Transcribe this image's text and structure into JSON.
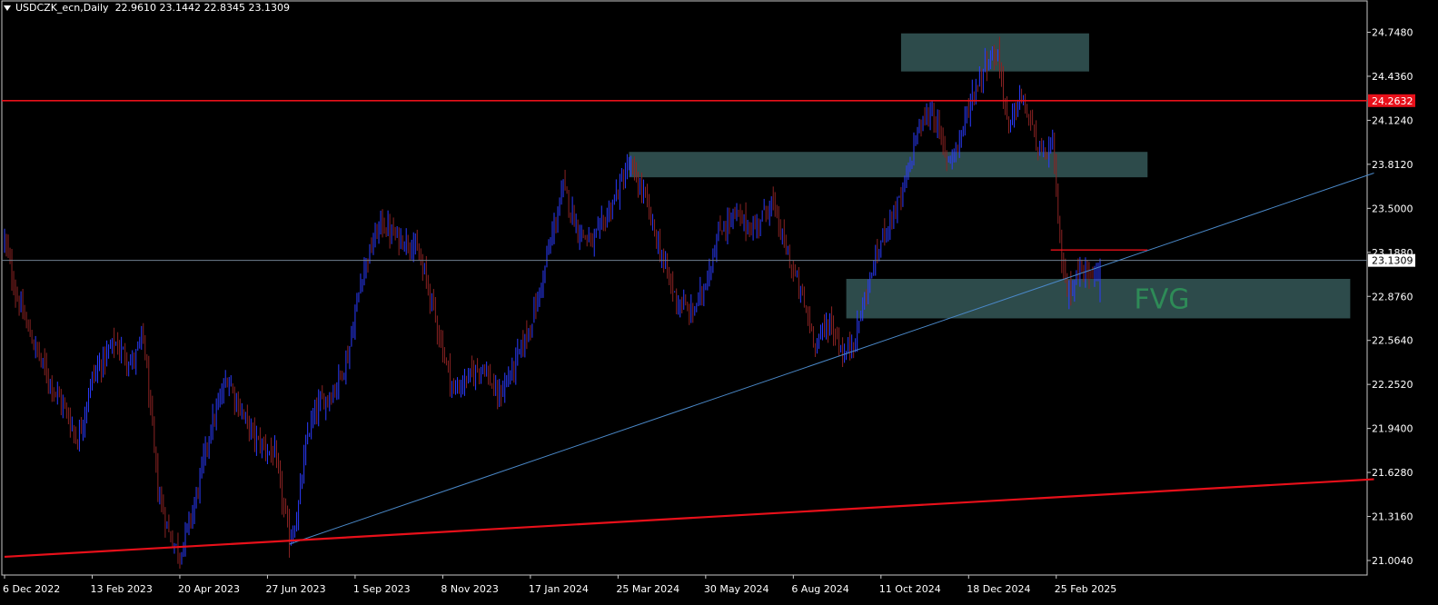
{
  "header": {
    "symbol_line": "USDCZK_ecn,Daily",
    "ohlc": "22.9610 23.1442 22.8345 23.1309"
  },
  "colors": {
    "background": "#000000",
    "bull": "#2b3bff",
    "bear": "#8b2323",
    "zone_fill": "#2f4f4f",
    "horizontal_red": "#e8101a",
    "trendline_blue": "#4a88c8",
    "current_price_line": "#708090",
    "fvg_text": "#2e8b57"
  },
  "chart_data": {
    "type": "candlestick",
    "symbol": "USDCZK_ecn",
    "timeframe": "Daily",
    "last_ohlc": {
      "open": 22.961,
      "high": 23.1442,
      "low": 22.8345,
      "close": 23.1309
    },
    "y_axis": {
      "ticks": [
        "24.7480",
        "24.4360",
        "24.1240",
        "23.8120",
        "23.5000",
        "23.1880",
        "22.8760",
        "22.5640",
        "22.2520",
        "21.9400",
        "21.6280",
        "21.3160",
        "21.0040"
      ],
      "range": [
        20.95,
        24.87
      ]
    },
    "x_axis": {
      "ticks": [
        "6 Dec 2022",
        "13 Feb 2023",
        "20 Apr 2023",
        "27 Jun 2023",
        "1 Sep 2023",
        "8 Nov 2023",
        "17 Jan 2024",
        "25 Mar 2024",
        "30 May 2024",
        "6 Aug 2024",
        "11 Oct 2024",
        "18 Dec 2024",
        "25 Feb 2025"
      ],
      "tick_slots": [
        0,
        48,
        96,
        144,
        192,
        240,
        288,
        336,
        384,
        432,
        480,
        528,
        576
      ],
      "slot_count": 750
    },
    "price_path": [
      [
        0,
        23.28
      ],
      [
        6,
        22.9
      ],
      [
        14,
        22.6
      ],
      [
        24,
        22.3
      ],
      [
        34,
        22.05
      ],
      [
        40,
        21.85
      ],
      [
        48,
        22.3
      ],
      [
        60,
        22.55
      ],
      [
        70,
        22.4
      ],
      [
        76,
        22.6
      ],
      [
        84,
        21.5
      ],
      [
        90,
        21.2
      ],
      [
        96,
        21.05
      ],
      [
        104,
        21.4
      ],
      [
        112,
        21.9
      ],
      [
        122,
        22.3
      ],
      [
        130,
        22.05
      ],
      [
        138,
        21.85
      ],
      [
        148,
        21.75
      ],
      [
        156,
        21.15
      ],
      [
        160,
        21.3
      ],
      [
        166,
        21.9
      ],
      [
        172,
        22.1
      ],
      [
        180,
        22.2
      ],
      [
        188,
        22.45
      ],
      [
        196,
        23.05
      ],
      [
        206,
        23.4
      ],
      [
        214,
        23.3
      ],
      [
        224,
        23.25
      ],
      [
        232,
        22.95
      ],
      [
        240,
        22.5
      ],
      [
        246,
        22.2
      ],
      [
        254,
        22.3
      ],
      [
        262,
        22.4
      ],
      [
        270,
        22.15
      ],
      [
        278,
        22.35
      ],
      [
        286,
        22.6
      ],
      [
        292,
        22.85
      ],
      [
        298,
        23.2
      ],
      [
        306,
        23.65
      ],
      [
        314,
        23.35
      ],
      [
        322,
        23.25
      ],
      [
        330,
        23.45
      ],
      [
        342,
        23.8
      ],
      [
        350,
        23.6
      ],
      [
        360,
        23.15
      ],
      [
        368,
        22.85
      ],
      [
        376,
        22.75
      ],
      [
        382,
        22.9
      ],
      [
        392,
        23.35
      ],
      [
        400,
        23.45
      ],
      [
        410,
        23.35
      ],
      [
        420,
        23.55
      ],
      [
        428,
        23.2
      ],
      [
        436,
        22.9
      ],
      [
        444,
        22.55
      ],
      [
        452,
        22.7
      ],
      [
        460,
        22.45
      ],
      [
        466,
        22.6
      ],
      [
        474,
        23.0
      ],
      [
        482,
        23.35
      ],
      [
        492,
        23.6
      ],
      [
        500,
        24.05
      ],
      [
        508,
        24.2
      ],
      [
        516,
        23.85
      ],
      [
        522,
        23.95
      ],
      [
        530,
        24.3
      ],
      [
        538,
        24.55
      ],
      [
        544,
        24.6
      ],
      [
        550,
        24.05
      ],
      [
        556,
        24.3
      ],
      [
        562,
        24.1
      ],
      [
        568,
        23.85
      ],
      [
        574,
        23.95
      ],
      [
        578,
        23.25
      ],
      [
        582,
        22.9
      ],
      [
        588,
        23.05
      ],
      [
        594,
        23.05
      ],
      [
        600,
        23.13
      ]
    ],
    "horizontal_lines": [
      {
        "price": 24.2632,
        "label": "24.2632",
        "color": "#e8101a"
      },
      {
        "price": 23.1309,
        "label": "23.1309",
        "color": "#708090"
      }
    ],
    "short_red_line": {
      "price": 23.205,
      "from_slot": 573,
      "to_slot": 626
    },
    "zones": [
      {
        "label": "",
        "top": 24.74,
        "bottom": 24.47,
        "from_slot": 491,
        "to_slot": 594
      },
      {
        "label": "",
        "top": 23.9,
        "bottom": 23.72,
        "from_slot": 342,
        "to_slot": 626
      },
      {
        "label": "FVG",
        "top": 23.0,
        "bottom": 22.72,
        "from_slot": 461,
        "to_slot": 737
      }
    ],
    "trendlines": [
      {
        "name": "blue",
        "from": [
          156,
          21.12
        ],
        "to": [
          750,
          23.75
        ]
      },
      {
        "name": "red",
        "from": [
          0,
          21.03
        ],
        "to": [
          750,
          21.58
        ]
      }
    ],
    "price_labels": {
      "horizontal_red": "24.2632",
      "current": "23.1309"
    }
  }
}
